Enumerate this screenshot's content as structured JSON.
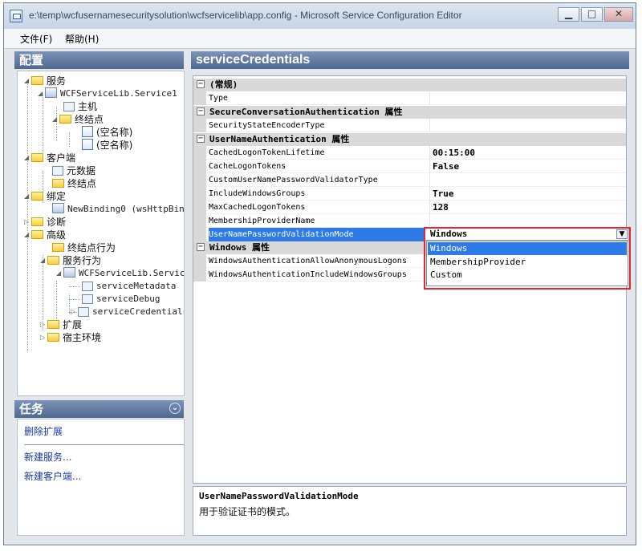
{
  "window": {
    "title": "e:\\temp\\wcfusernamesecuritysolution\\wcfservicelib\\app.config - Microsoft Service Configuration Editor"
  },
  "menu": [
    {
      "label": "文件(F)"
    },
    {
      "label": "帮助(H)"
    }
  ],
  "panels": {
    "config_title": "配置",
    "tasks_title": "任务",
    "right_title": "serviceCredentials"
  },
  "tree": [
    {
      "label": "服务"
    },
    {
      "label": "WCFServiceLib.Service1"
    },
    {
      "label": "主机"
    },
    {
      "label": "终结点"
    },
    {
      "label": "(空名称)"
    },
    {
      "label": "(空名称)"
    },
    {
      "label": "客户端"
    },
    {
      "label": "元数据"
    },
    {
      "label": "终结点"
    },
    {
      "label": "绑定"
    },
    {
      "label": "NewBinding0 (wsHttpBindi"
    },
    {
      "label": "诊断"
    },
    {
      "label": "高级"
    },
    {
      "label": "终结点行为"
    },
    {
      "label": "服务行为"
    },
    {
      "label": "WCFServiceLib.Service"
    },
    {
      "label": "serviceMetadata"
    },
    {
      "label": "serviceDebug"
    },
    {
      "label": "serviceCredentials"
    },
    {
      "label": "扩展"
    },
    {
      "label": "宿主环境"
    }
  ],
  "tasks": [
    {
      "label": "删除扩展"
    },
    {
      "label": "新建服务..."
    },
    {
      "label": "新建客户端..."
    }
  ],
  "property_categories": [
    {
      "label": "(常规)"
    },
    {
      "label": "SecureConversationAuthentication 属性"
    },
    {
      "label": "UserNameAuthentication 属性"
    },
    {
      "label": "Windows 属性"
    }
  ],
  "properties": [
    {
      "name": "Type",
      "value": ""
    },
    {
      "name": "SecurityStateEncoderType",
      "value": ""
    },
    {
      "name": "CachedLogonTokenLifetime",
      "value": "00:15:00"
    },
    {
      "name": "CacheLogonTokens",
      "value": "False"
    },
    {
      "name": "CustomUserNamePasswordValidatorType",
      "value": ""
    },
    {
      "name": "IncludeWindowsGroups",
      "value": "True"
    },
    {
      "name": "MaxCachedLogonTokens",
      "value": "128"
    },
    {
      "name": "MembershipProviderName",
      "value": ""
    },
    {
      "name": "UserNamePasswordValidationMode",
      "value": "Windows"
    },
    {
      "name": "WindowsAuthenticationAllowAnonymousLogons",
      "value": ""
    },
    {
      "name": "WindowsAuthenticationIncludeWindowsGroups",
      "value": ""
    }
  ],
  "dropdown": {
    "options": [
      "Windows",
      "MembershipProvider",
      "Custom"
    ]
  },
  "description": {
    "title": "UserNamePasswordValidationMode",
    "text": "用于验证证书的模式。"
  },
  "colors": {
    "header": "#5f789d",
    "selection": "#2e7be8",
    "highlight": "#e4272c"
  }
}
